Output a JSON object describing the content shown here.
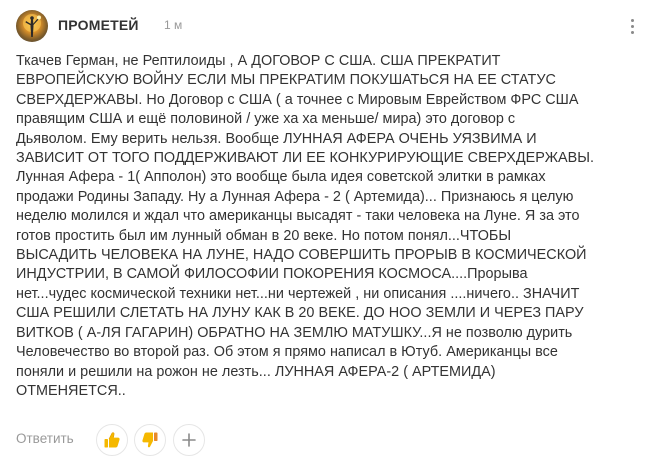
{
  "comment": {
    "author": "ПРОМЕТЕЙ",
    "time": "1 м",
    "text_lines": [
      "Ткачев Герман, не Рептилоиды , А ДОГОВОР С США. США ПРЕКРАТИТ",
      "ЕВРОПЕЙСКУЮ ВОЙНУ ЕСЛИ МЫ ПРЕКРАТИМ ПОКУШАТЬСЯ НА ЕЕ СТАТУС",
      "СВЕРХДЕРЖАВЫ. Но Договор с США ( а точнее с Мировым Еврейством ФРС США",
      "правящим США и ещё половиной / уже ха ха меньше/ мира) это договор с",
      "Дьяволом. Ему верить нельзя. Вообще ЛУННАЯ АФЕРА ОЧЕНЬ УЯЗВИМА И",
      "ЗАВИСИТ ОТ ТОГО ПОДДЕРЖИВАЮТ ЛИ ЕЕ КОНКУРИРУЮЩИЕ СВЕРХДЕРЖАВЫ.",
      "Лунная Афера - 1( Апполон) это вообще была идея советской элитки в рамках",
      "продажи Родины Западу. Ну а Лунная Афера - 2 ( Артемида)... Признаюсь я целую",
      "неделю молился и ждал что американцы высадят - таки человека на Луне. Я за это",
      "готов простить был им лунный обман в 20 веке. Но потом понял...ЧТОБЫ",
      "ВЫСАДИТЬ ЧЕЛОВЕКА НА ЛУНЕ, НАДО СОВЕРШИТЬ ПРОРЫВ В КОСМИЧЕСКОЙ",
      "ИНДУСТРИИ, В САМОЙ ФИЛОСОФИИ ПОКОРЕНИЯ КОСМОСА....Прорыва",
      "нет...чудес космической техники нет...ни чертежей , ни описания ....ничего.. ЗНАЧИТ",
      "США РЕШИЛИ СЛЕТАТЬ НА ЛУНУ КАК В 20 ВЕКЕ. ДО НОО ЗЕМЛИ И ЧЕРЕЗ ПАРУ",
      "ВИТКОВ ( А-ЛЯ ГАГАРИН) ОБРАТНО НА ЗЕМЛЮ МАТУШКУ...Я не позволю дурить",
      "Человечество во второй раз. Об этом я прямо написал в Ютуб. Американцы все",
      "поняли и решили на рожон не лезть... ЛУННАЯ АФЕРА-2 ( АРТЕМИДА)",
      "ОТМЕНЯЕТСЯ.."
    ]
  },
  "actions": {
    "reply_label": "Ответить"
  },
  "icons": {
    "avatar": "avatar-image",
    "menu": "more-vertical-icon",
    "like": "thumbs-up-icon",
    "dislike": "thumbs-down-icon",
    "add_reaction": "plus-icon"
  },
  "colors": {
    "text": "#333333",
    "muted": "#999999",
    "reaction_yellow": "#f5b800",
    "reaction_dislike": "#f0a23a",
    "border": "#e6e6e6"
  }
}
